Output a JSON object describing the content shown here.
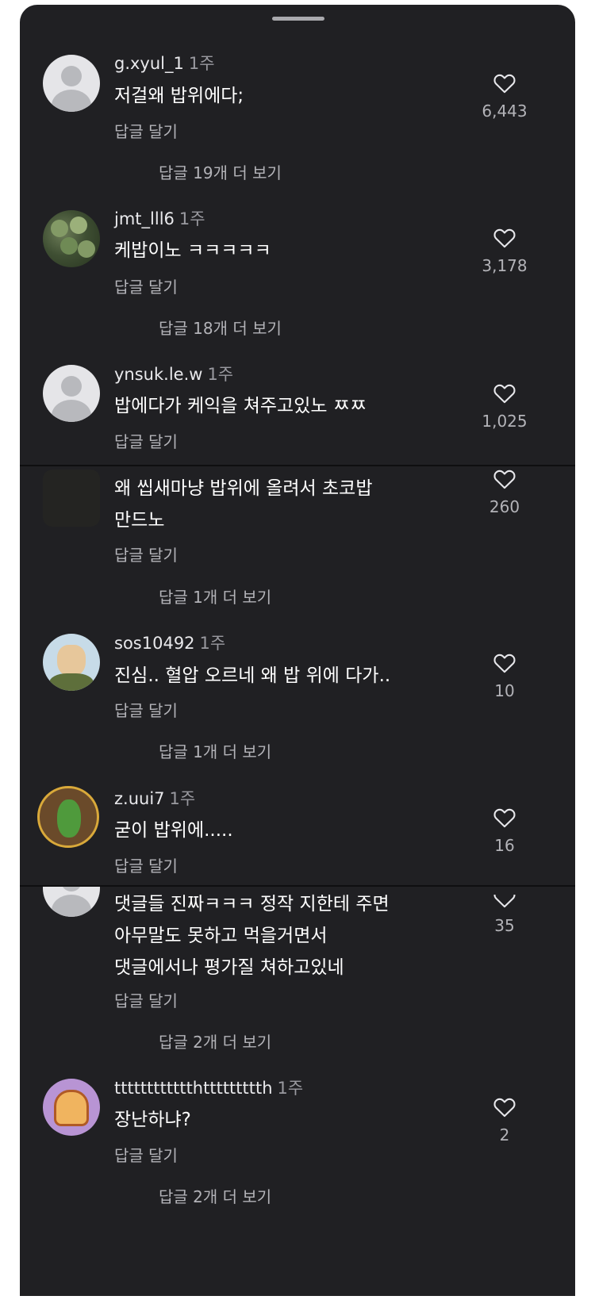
{
  "reply_label": "답글 달기",
  "comments": [
    {
      "username": "g.xyul_1",
      "time": "1주",
      "text": [
        "저걸왜 밥위에다;"
      ],
      "likes": "6,443",
      "more_replies": "답글 19개 더 보기"
    },
    {
      "username": "jmt_lll6",
      "time": "1주",
      "text": [
        "케밥이노 ㅋㅋㅋㅋㅋ"
      ],
      "likes": "3,178",
      "more_replies": "답글 18개 더 보기"
    },
    {
      "username": "ynsuk.le.w",
      "time": "1주",
      "text": [
        "밥에다가 케익을 쳐주고있노 ㅉㅉ"
      ],
      "likes": "1,025",
      "more_replies": ""
    },
    {
      "username": "",
      "time": "",
      "text": [
        "왜 씹새마냥 밥위에 올려서 초코밥",
        "만드노"
      ],
      "likes": "260",
      "more_replies": "답글 1개 더 보기"
    },
    {
      "username": "sos10492",
      "time": "1주",
      "text": [
        "진심.. 혈압 오르네 왜 밥 위에 다가.."
      ],
      "likes": "10",
      "more_replies": "답글 1개 더 보기"
    },
    {
      "username": "z.uui7",
      "time": "1주",
      "text": [
        "굳이 밥위에....."
      ],
      "likes": "16",
      "more_replies": ""
    },
    {
      "username": "",
      "time": "",
      "text": [
        "댓글들 진짜ㅋㅋㅋ 정작 지한테 주면",
        "아무말도 못하고 먹을거면서",
        "댓글에서나 평가질 쳐하고있네"
      ],
      "likes": "35",
      "more_replies": "답글 2개 더 보기"
    },
    {
      "username": "tttttttttttthttttttttth",
      "time": "1주",
      "text": [
        "장난하냐?"
      ],
      "likes": "2",
      "more_replies": "답글 2개 더 보기"
    }
  ],
  "icons": {
    "like": "heart-outline-icon",
    "avatar_default": "default-avatar-icon"
  },
  "colors": {
    "sheet": "#202023",
    "text": "#ffffff",
    "secondary": "#b3b3b8"
  }
}
